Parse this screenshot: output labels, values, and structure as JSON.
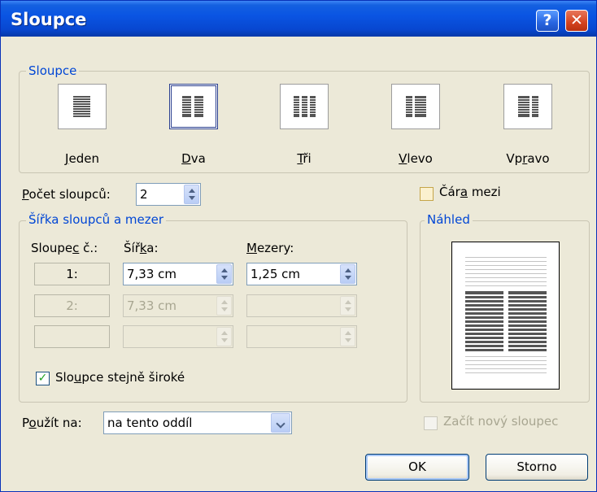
{
  "window": {
    "title": "Sloupce",
    "help_glyph": "?",
    "close_glyph": "✕"
  },
  "presets_group": {
    "title": "Sloupce",
    "items": [
      {
        "label_pre": "",
        "label_u": "J",
        "label_post": "eden",
        "columns": 1,
        "selected": false
      },
      {
        "label_pre": "",
        "label_u": "D",
        "label_post": "va",
        "columns": 2,
        "selected": true
      },
      {
        "label_pre": "",
        "label_u": "T",
        "label_post": "ři",
        "columns": 3,
        "selected": false
      },
      {
        "label_pre": "",
        "label_u": "V",
        "label_post": "levo",
        "columns": "left",
        "selected": false
      },
      {
        "label_pre": "Vp",
        "label_u": "r",
        "label_post": "avo",
        "columns": "right",
        "selected": false
      }
    ]
  },
  "count": {
    "label_u": "P",
    "label_post": "očet sloupců:",
    "value": "2"
  },
  "line_between": {
    "label_pre": "Čár",
    "label_u": "a",
    "label_post": " mezi",
    "checked": false
  },
  "width_group": {
    "title": "Šířka sloupců a mezer",
    "col_header_pre": "Sloupe",
    "col_header_u": "c",
    "col_header_post": " č.:",
    "width_header_pre": "Šíř",
    "width_header_u": "k",
    "width_header_post": "a:",
    "spacing_header_u": "M",
    "spacing_header_post": "ezery:",
    "rows": [
      {
        "col": "1:",
        "width": "7,33 cm",
        "spacing": "1,25 cm",
        "enabled": true
      },
      {
        "col": "2:",
        "width": "7,33 cm",
        "spacing": "",
        "enabled": false
      },
      {
        "col": "",
        "width": "",
        "spacing": "",
        "enabled": false
      }
    ],
    "equal_width": {
      "label_pre": "Slo",
      "label_u": "u",
      "label_post": "pce stejně široké",
      "checked": true
    }
  },
  "preview_group": {
    "title": "Náhled"
  },
  "apply_to": {
    "label_pre": "P",
    "label_u": "o",
    "label_post": "užít na:",
    "value": "na tento oddíl"
  },
  "start_new_column": {
    "label": "Začít nový sloupec",
    "checked": false,
    "enabled": false
  },
  "buttons": {
    "ok": "OK",
    "cancel": "Storno"
  },
  "colors": {
    "titlebar": "#0a55e3",
    "group_title": "#0046d5",
    "dialog_bg": "#ece9d8"
  }
}
